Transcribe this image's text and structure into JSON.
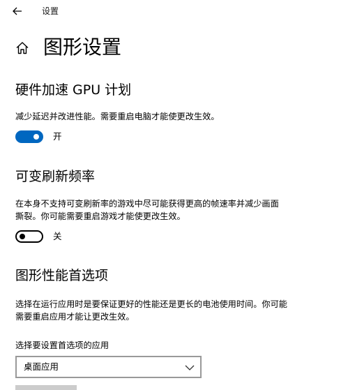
{
  "window": {
    "title": "设置"
  },
  "header": {
    "page_title": "图形设置"
  },
  "gpu_scheduling": {
    "title": "硬件加速 GPU 计划",
    "description": "减少延迟并改进性能。需要重启电脑才能使更改生效。",
    "toggle_state": "on",
    "toggle_label": "开"
  },
  "vrr": {
    "title": "可变刷新频率",
    "description_line1": "在本身不支持可变刷新率的游戏中尽可能获得更高的帧速率并减少画面",
    "description_line2": "撕裂。你可能需要重启游戏才能使更改生效。",
    "toggle_state": "off",
    "toggle_label": "关"
  },
  "graphics_preference": {
    "title": "图形性能首选项",
    "description_line1": "选择在运行应用时是要保证更好的性能还是更长的电池使用时间。你可能",
    "description_line2": "需要重启应用才能让更改生效。",
    "select_caption": "选择要设置首选项的应用",
    "selected_app_type": "桌面应用"
  },
  "colors": {
    "accent": "#0067c0",
    "border": "#999999"
  },
  "icons": {
    "back": "back-arrow-icon",
    "home": "home-icon",
    "dropdown": "chevron-down-icon"
  }
}
